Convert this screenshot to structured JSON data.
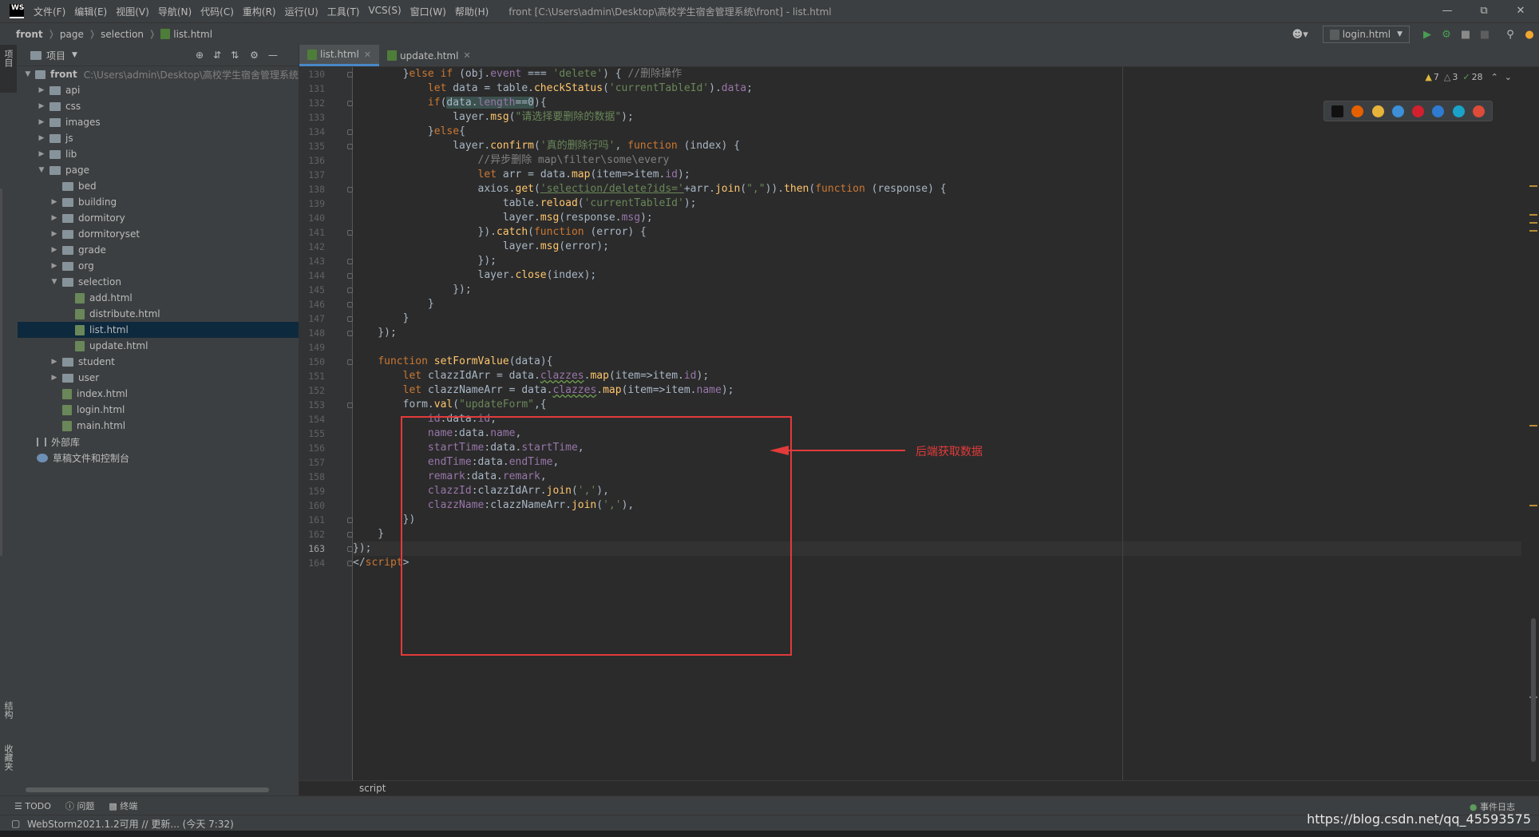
{
  "window": {
    "title": "front [C:\\Users\\admin\\Desktop\\高校学生宿舍管理系统\\front] - list.html",
    "menu": [
      "文件(F)",
      "编辑(E)",
      "视图(V)",
      "导航(N)",
      "代码(C)",
      "重构(R)",
      "运行(U)",
      "工具(T)",
      "VCS(S)",
      "窗口(W)",
      "帮助(H)"
    ],
    "logo": "WS"
  },
  "breadcrumb": [
    "front",
    "page",
    "selection",
    "list.html"
  ],
  "run_config": "login.html",
  "project_panel": {
    "title": "项目",
    "tree": [
      {
        "label": "front",
        "path": "C:\\Users\\admin\\Desktop\\高校学生宿舍管理系统",
        "type": "root",
        "expanded": true,
        "depth": 0
      },
      {
        "label": "api",
        "type": "folder",
        "depth": 1
      },
      {
        "label": "css",
        "type": "folder",
        "depth": 1
      },
      {
        "label": "images",
        "type": "folder",
        "depth": 1
      },
      {
        "label": "js",
        "type": "folder",
        "depth": 1
      },
      {
        "label": "lib",
        "type": "folder",
        "depth": 1
      },
      {
        "label": "page",
        "type": "folder",
        "expanded": true,
        "depth": 1
      },
      {
        "label": "bed",
        "type": "folder-leaf",
        "depth": 2
      },
      {
        "label": "building",
        "type": "folder",
        "depth": 2
      },
      {
        "label": "dormitory",
        "type": "folder",
        "depth": 2
      },
      {
        "label": "dormitoryset",
        "type": "folder",
        "depth": 2
      },
      {
        "label": "grade",
        "type": "folder",
        "depth": 2
      },
      {
        "label": "org",
        "type": "folder",
        "depth": 2
      },
      {
        "label": "selection",
        "type": "folder",
        "expanded": true,
        "depth": 2
      },
      {
        "label": "add.html",
        "type": "file",
        "depth": 3
      },
      {
        "label": "distribute.html",
        "type": "file",
        "depth": 3
      },
      {
        "label": "list.html",
        "type": "file",
        "depth": 3,
        "selected": true
      },
      {
        "label": "update.html",
        "type": "file",
        "depth": 3
      },
      {
        "label": "student",
        "type": "folder",
        "depth": 2
      },
      {
        "label": "user",
        "type": "folder",
        "depth": 2
      },
      {
        "label": "index.html",
        "type": "file",
        "depth": 2
      },
      {
        "label": "login.html",
        "type": "file",
        "depth": 2
      },
      {
        "label": "main.html",
        "type": "file",
        "depth": 2
      },
      {
        "label": "外部库",
        "type": "lib",
        "depth": 0
      },
      {
        "label": "草稿文件和控制台",
        "type": "scratch",
        "depth": 0
      }
    ]
  },
  "left_strip_labels": [
    "项目",
    "结构",
    "收藏夹"
  ],
  "editor_tabs": [
    {
      "label": "list.html",
      "active": true
    },
    {
      "label": "update.html",
      "active": false
    }
  ],
  "inspections": {
    "warnings": "7",
    "weak": "3",
    "ok": "28"
  },
  "code_lines": [
    {
      "n": "130",
      "html": "        }<span class='kw'>else if </span>(obj.<span class='prop'>event</span> === <span class='str'>'delete'</span>) { <span class='cmt'>//删除操作</span>"
    },
    {
      "n": "131",
      "html": "            <span class='kw'>let </span>data = table.<span class='fn'>checkStatus</span>(<span class='str'>'currentTableId'</span>).<span class='prop'>data</span>;"
    },
    {
      "n": "132",
      "html": "            <span class='kw'>if</span>(<span class='hl'>data.<span class='prop'>length</span>==0</span>){"
    },
    {
      "n": "133",
      "html": "                layer.<span class='fn'>msg</span>(<span class='str'>\"请选择要删除的数据\"</span>);"
    },
    {
      "n": "134",
      "html": "            }<span class='kw'>else</span>{"
    },
    {
      "n": "135",
      "html": "                layer.<span class='fn'>confirm</span>(<span class='str'>'真的删除行吗'</span>, <span class='kw'>function </span>(index) {"
    },
    {
      "n": "136",
      "html": "                    <span class='cmt'>//异步删除 map\\filter\\some\\every</span>"
    },
    {
      "n": "137",
      "html": "                    <span class='kw'>let </span>arr = data.<span class='fn'>map</span>(item=>item.<span class='prop'>id</span>);"
    },
    {
      "n": "138",
      "html": "                    axios.<span class='fn'>get</span>(<span class='url'>'selection/delete?ids='</span>+arr.<span class='fn'>join</span>(<span class='str'>\",\"</span>)).<span class='fn'>then</span>(<span class='kw'>function </span>(response) {"
    },
    {
      "n": "139",
      "html": "                        table.<span class='fn'>reload</span>(<span class='str'>'currentTableId'</span>);"
    },
    {
      "n": "140",
      "html": "                        layer.<span class='fn'>msg</span>(response.<span class='prop'>msg</span>);"
    },
    {
      "n": "141",
      "html": "                    }).<span class='fn'>catch</span>(<span class='kw'>function </span>(error) {"
    },
    {
      "n": "142",
      "html": "                        layer.<span class='fn'>msg</span>(error);"
    },
    {
      "n": "143",
      "html": "                    });"
    },
    {
      "n": "144",
      "html": "                    layer.<span class='fn'>close</span>(index);"
    },
    {
      "n": "145",
      "html": "                });"
    },
    {
      "n": "146",
      "html": "            }"
    },
    {
      "n": "147",
      "html": "        }"
    },
    {
      "n": "148",
      "html": "    });"
    },
    {
      "n": "149",
      "html": ""
    },
    {
      "n": "150",
      "html": "    <span class='kw'>function </span><span class='fn'>setFormValue</span>(data){"
    },
    {
      "n": "151",
      "html": "        <span class='kw'>let </span>clazzIdArr = data.<span class='prop typo'>clazzes</span>.<span class='fn'>map</span>(item=>item.<span class='prop'>id</span>);"
    },
    {
      "n": "152",
      "html": "        <span class='kw'>let </span>clazzNameArr = data.<span class='prop typo'>clazzes</span>.<span class='fn'>map</span>(item=>item.<span class='prop'>name</span>);"
    },
    {
      "n": "153",
      "html": "        form.<span class='fn'>val</span>(<span class='str'>\"updateForm\"</span>,{"
    },
    {
      "n": "154",
      "html": "            <span class='prop'>id</span>:data.<span class='prop'>id</span>,"
    },
    {
      "n": "155",
      "html": "            <span class='prop'>name</span>:data.<span class='prop'>name</span>,"
    },
    {
      "n": "156",
      "html": "            <span class='prop'>startTime</span>:data.<span class='prop'>startTime</span>,"
    },
    {
      "n": "157",
      "html": "            <span class='prop'>endTime</span>:data.<span class='prop'>endTime</span>,"
    },
    {
      "n": "158",
      "html": "            <span class='prop'>remark</span>:data.<span class='prop'>remark</span>,"
    },
    {
      "n": "159",
      "html": "            <span class='prop'>clazzId</span>:clazzIdArr.<span class='fn'>join</span>(<span class='str'>','</span>),"
    },
    {
      "n": "160",
      "html": "            <span class='prop'>clazzName</span>:clazzNameArr.<span class='fn'>join</span>(<span class='str'>','</span>),"
    },
    {
      "n": "161",
      "html": "        })"
    },
    {
      "n": "162",
      "html": "    }"
    },
    {
      "n": "163",
      "html": "});",
      "current": true
    },
    {
      "n": "164",
      "html": "&lt;/<span class='kw'>script</span>&gt;"
    }
  ],
  "annotation": {
    "label": "后端获取数据",
    "color": "#e33a3a"
  },
  "code_breadcrumb": "script",
  "bottom_tools": [
    "TODO",
    "问题",
    "终端"
  ],
  "event_log": "事件日志",
  "status_text": "WebStorm2021.1.2可用 // 更新... (今天 7:32)",
  "watermark": "https://blog.csdn.net/qq_45593575"
}
